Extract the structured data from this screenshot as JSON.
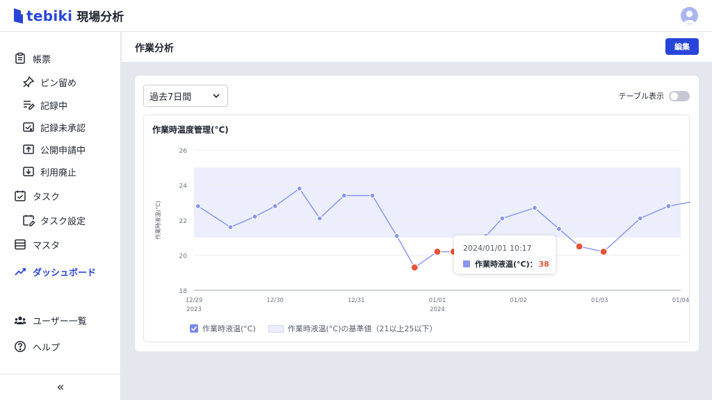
{
  "app": {
    "brand": "tebiki",
    "section": "現場分析"
  },
  "sidebar": {
    "items": [
      {
        "label": "帳票"
      },
      {
        "label": "ピン留め"
      },
      {
        "label": "記録中"
      },
      {
        "label": "記録未承認"
      },
      {
        "label": "公開申請中"
      },
      {
        "label": "利用廃止"
      },
      {
        "label": "タスク"
      },
      {
        "label": "タスク設定"
      },
      {
        "label": "マスタ"
      },
      {
        "label": "ダッシュボード"
      },
      {
        "label": "ユーザー一覧"
      },
      {
        "label": "ヘルプ"
      }
    ],
    "collapse_label": "«"
  },
  "page": {
    "title": "作業分析",
    "edit_label": "編集"
  },
  "controls": {
    "period": "過去7日間",
    "table_toggle_label": "テーブル表示",
    "table_toggle_on": false
  },
  "colors": {
    "accent": "#2945d9",
    "line": "#8a96f0",
    "out_of_range": "#e5533a",
    "band": "#eceefd"
  },
  "tooltip": {
    "time": "2024/01/01 10:17",
    "series": "作業時液温(°C)：",
    "value": "38"
  },
  "legend": {
    "series": "作業時液温(°C)",
    "band": "作業時液温(°C)の基準値（21以上25以下）"
  },
  "chart_data": {
    "type": "line",
    "title": "作業時温度管理(°C)",
    "ylabel": "作業時液温(°C)",
    "xlabel": "",
    "ylim": [
      18,
      26
    ],
    "y_ticks": [
      18,
      20,
      22,
      24,
      26
    ],
    "band": {
      "low": 21,
      "high": 25
    },
    "x_ticks": [
      {
        "line1": "12/29",
        "line2": "2023"
      },
      {
        "line1": "12/30",
        "line2": ""
      },
      {
        "line1": "12/31",
        "line2": ""
      },
      {
        "line1": "01/01",
        "line2": "2024"
      },
      {
        "line1": "01/02",
        "line2": ""
      },
      {
        "line1": "01/03",
        "line2": ""
      },
      {
        "line1": "01/04",
        "line2": ""
      }
    ],
    "series": [
      {
        "name": "作業時液温(°C)",
        "x": [
          0.05,
          0.45,
          0.75,
          1.0,
          1.3,
          1.55,
          1.85,
          2.2,
          2.5,
          2.72,
          3.0,
          3.2,
          3.6,
          3.8,
          4.2,
          4.5,
          4.75,
          5.05,
          5.5,
          5.85,
          6.2
        ],
        "values": [
          22.8,
          21.6,
          22.2,
          22.8,
          23.8,
          22.1,
          23.4,
          23.4,
          21.1,
          19.3,
          20.2,
          20.2,
          21.1,
          22.1,
          22.7,
          21.5,
          20.5,
          20.2,
          22.1,
          22.8,
          23.1
        ]
      }
    ]
  }
}
